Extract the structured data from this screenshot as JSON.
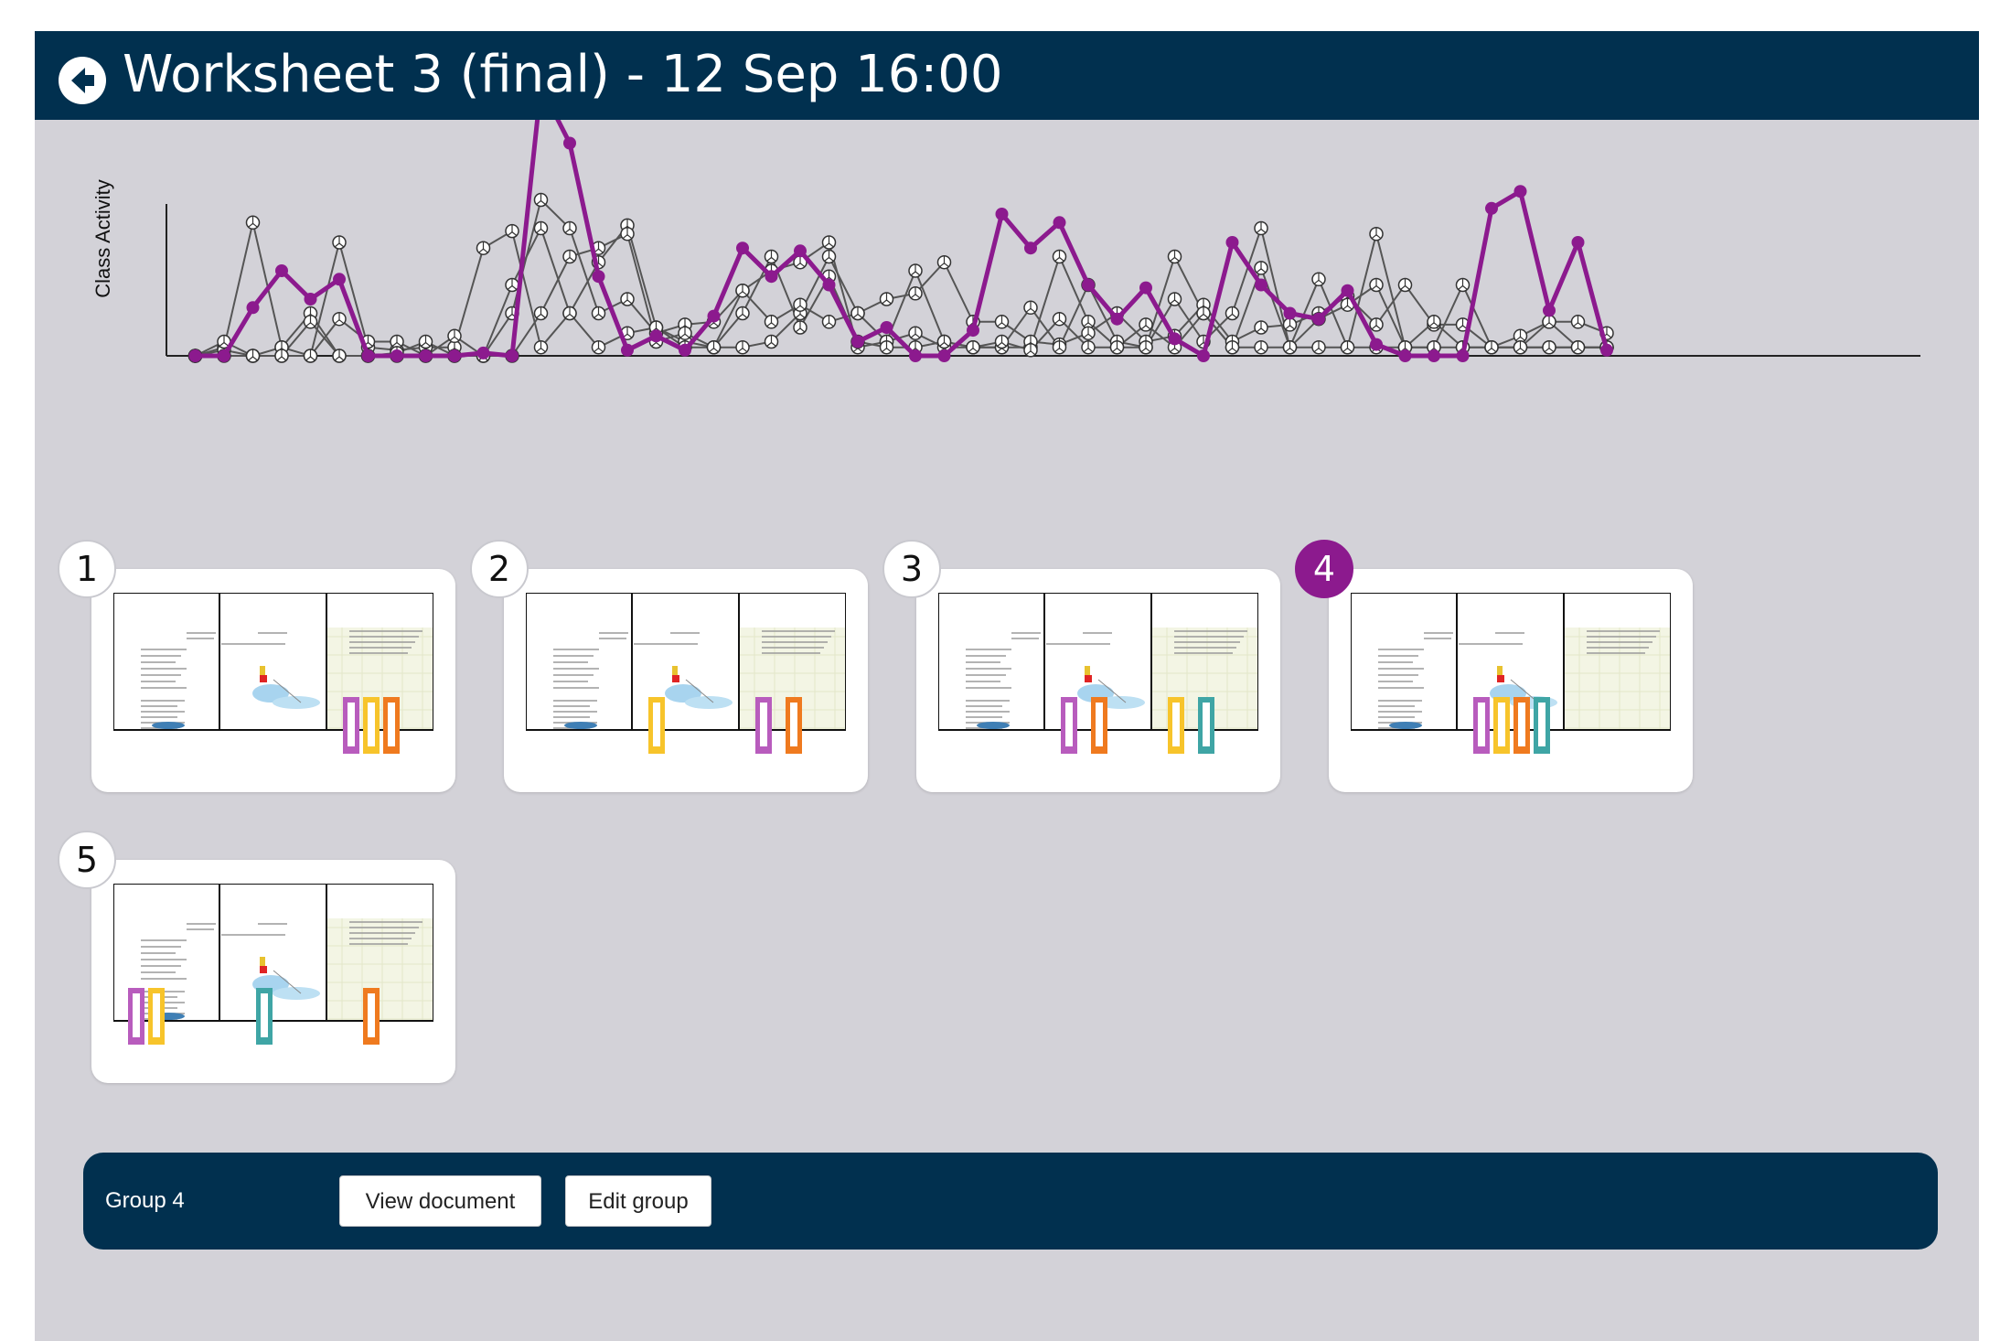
{
  "header": {
    "title": "Worksheet 3 (final) - 12 Sep 16:00",
    "back_icon": "back-arrow-circle-icon"
  },
  "colors": {
    "header_bg": "#01304f",
    "page_bg": "#d3d2d8",
    "selected": "#8c1a8e",
    "other_series": "#555555",
    "bar_colors": {
      "purple": "#b85cbd",
      "yellow": "#f7c42b",
      "orange": "#ef7a1f",
      "teal": "#3fa5a5"
    }
  },
  "chart_data": {
    "type": "line",
    "ylabel": "Class Activity",
    "xlabel": "",
    "x_count": 60,
    "ylim": [
      0,
      10
    ],
    "series": [
      {
        "highlight": true,
        "values": [
          0,
          0,
          1.7,
          3,
          2,
          2.7,
          0,
          0,
          0,
          0,
          0.1,
          0,
          9.5,
          7.5,
          2.8,
          0.2,
          0.7,
          0.2,
          1.4,
          3.8,
          2.8,
          3.7,
          2.5,
          0.5,
          1,
          0,
          0,
          0.9,
          5,
          3.8,
          4.7,
          2.5,
          1.3,
          2.4,
          0.6,
          0,
          4,
          2.5,
          1.5,
          1.3,
          2.3,
          0.4,
          0,
          0,
          0,
          5.2,
          5.8,
          1.6,
          4,
          0.2,
          0,
          0,
          0,
          0,
          0,
          0,
          0,
          0,
          0,
          0
        ]
      },
      {
        "values": [
          0,
          0.3,
          4.7,
          0.3,
          0,
          4,
          0.3,
          0.2,
          0.3,
          0.3,
          3.8,
          4.4,
          0.3,
          1.5,
          3.3,
          4.6,
          1,
          0.5,
          0.3,
          0.3,
          0.5,
          1.5,
          3.5,
          1.5,
          0.5,
          3,
          0.5,
          0.3,
          0.3,
          0.3,
          3.5,
          1.2,
          0.3,
          0.3,
          3.5,
          1.5,
          0.3,
          0.3,
          0.3,
          0.3,
          0.3,
          4.3,
          0.3,
          0.3,
          2.5,
          0.3,
          0.3,
          0.3,
          0.3,
          0.3,
          0.3,
          0,
          0,
          0,
          0,
          0,
          0,
          0,
          0,
          0
        ]
      },
      {
        "values": [
          0,
          0.2,
          0,
          0,
          0,
          1.3,
          0.5,
          0.5,
          0,
          0.7,
          0,
          1.5,
          5.5,
          4.5,
          1.5,
          2,
          0.8,
          1.1,
          1.2,
          2.3,
          1.2,
          1.8,
          1.2,
          1.5,
          2,
          2.2,
          3.3,
          1.2,
          1.2,
          0.5,
          0.4,
          0.8,
          1.5,
          0.5,
          0.7,
          1.8,
          0.5,
          1,
          1.1,
          1.5,
          2.1,
          1.1,
          2.5,
          1.1,
          1.1,
          0.3,
          0.7,
          1.2,
          1.2,
          0.8,
          0.5,
          0,
          0,
          0,
          0,
          0,
          0,
          0,
          0,
          0
        ]
      },
      {
        "values": [
          0,
          0.5,
          0,
          0.3,
          1.5,
          0,
          0,
          0,
          0,
          0,
          0,
          0,
          1.5,
          3.5,
          3.8,
          4.3,
          0.5,
          0.8,
          0.3,
          2.3,
          3,
          3.3,
          4,
          0.3,
          0.5,
          0.8,
          0.3,
          0.3,
          0.3,
          1.7,
          0.3,
          2.5,
          0.5,
          0.3,
          2,
          0.5,
          1.5,
          4.5,
          0.3,
          1.3,
          1.8,
          2.5,
          0.3,
          0.3,
          0.3,
          0.3,
          0.3,
          1.2,
          0.3,
          0.3,
          0,
          0,
          0,
          0,
          0,
          0,
          0,
          0,
          0,
          0
        ]
      },
      {
        "values": [
          0,
          0,
          0,
          0,
          1.2,
          0,
          0,
          0.1,
          0.5,
          0,
          0,
          2.5,
          4.5,
          1.5,
          0.3,
          0.8,
          1,
          0.3,
          0.3,
          1.5,
          3.5,
          1,
          2.8,
          0.5,
          0.3,
          0.3,
          0.5,
          0.3,
          0.5,
          0.2,
          1.3,
          0.3,
          0.3,
          1.1,
          0.3,
          1.5,
          0.3,
          3.1,
          0.3,
          2.7,
          0.3,
          0.3,
          0.3,
          1.2,
          0.3,
          0.3,
          0.3,
          0.3,
          0.3,
          0.3,
          0.3,
          0,
          0,
          0,
          0,
          0,
          0,
          0,
          0,
          0
        ]
      }
    ]
  },
  "groups": [
    {
      "number": "1",
      "selected": false,
      "bars": [
        {
          "color": "purple",
          "page": 2,
          "offset": 0
        },
        {
          "color": "yellow",
          "page": 2,
          "offset": 1
        },
        {
          "color": "orange",
          "page": 2,
          "offset": 2
        }
      ]
    },
    {
      "number": "2",
      "selected": false,
      "bars": [
        {
          "color": "yellow",
          "page": 1,
          "offset": 0
        },
        {
          "color": "purple",
          "page": 2,
          "offset": 0
        },
        {
          "color": "orange",
          "page": 2,
          "offset": 1.5
        }
      ]
    },
    {
      "number": "3",
      "selected": false,
      "bars": [
        {
          "color": "purple",
          "page": 1,
          "offset": 0
        },
        {
          "color": "orange",
          "page": 1,
          "offset": 1.5
        },
        {
          "color": "yellow",
          "page": 2,
          "offset": 0
        },
        {
          "color": "teal",
          "page": 2,
          "offset": 1.5
        }
      ]
    },
    {
      "number": "4",
      "selected": true,
      "bars": [
        {
          "color": "purple",
          "page": 1,
          "offset": 0
        },
        {
          "color": "yellow",
          "page": 1,
          "offset": 1
        },
        {
          "color": "orange",
          "page": 1,
          "offset": 2
        },
        {
          "color": "teal",
          "page": 1,
          "offset": 3
        }
      ]
    },
    {
      "number": "5",
      "selected": false,
      "bars": [
        {
          "color": "purple",
          "page": 0,
          "offset": 0
        },
        {
          "color": "yellow",
          "page": 0,
          "offset": 1
        },
        {
          "color": "teal",
          "page": 1,
          "offset": 1
        },
        {
          "color": "orange",
          "page": 2,
          "offset": 1
        }
      ]
    }
  ],
  "footer": {
    "group_label": "Group 4",
    "view_document_label": "View document",
    "edit_group_label": "Edit group"
  }
}
